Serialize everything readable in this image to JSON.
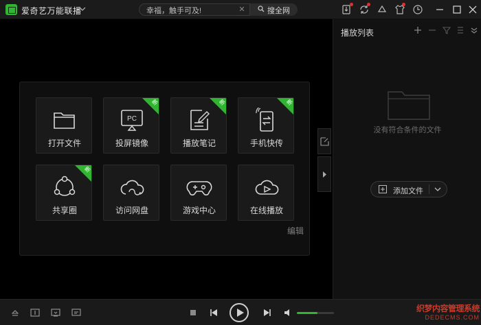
{
  "app": {
    "title": "爱奇艺万能联播"
  },
  "search": {
    "value": "幸福，触手可及!",
    "button_label": "搜全网"
  },
  "tiles": [
    {
      "label": "打开文件",
      "icon": "folder-icon",
      "new": false
    },
    {
      "label": "投屏镜像",
      "icon": "pc-cast-icon",
      "new": true
    },
    {
      "label": "播放笔记",
      "icon": "note-icon",
      "new": true
    },
    {
      "label": "手机快传",
      "icon": "phone-transfer-icon",
      "new": true
    },
    {
      "label": "共享圈",
      "icon": "share-circle-icon",
      "new": true
    },
    {
      "label": "访问网盘",
      "icon": "cloud-drive-icon",
      "new": false
    },
    {
      "label": "游戏中心",
      "icon": "gamepad-icon",
      "new": false
    },
    {
      "label": "在线播放",
      "icon": "cloud-play-icon",
      "new": false
    }
  ],
  "ribbon_text": "新",
  "panel": {
    "edit_label": "编辑"
  },
  "playlist": {
    "title": "播放列表",
    "empty_text": "没有符合条件的文件",
    "add_file_label": "添加文件"
  },
  "volume": {
    "level": 0.55
  },
  "watermark": {
    "line1": "织梦内容管理系统",
    "line2": "DEDECMS.COM"
  },
  "colors": {
    "accent": "#2fb82f",
    "background": "#000000"
  }
}
